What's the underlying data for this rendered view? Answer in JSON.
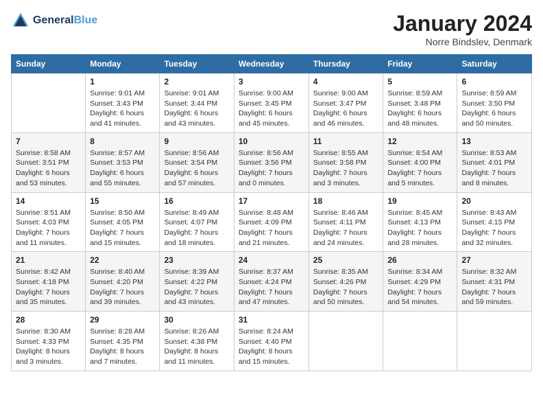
{
  "header": {
    "logo_line1": "General",
    "logo_line2": "Blue",
    "month_title": "January 2024",
    "subtitle": "Norre Bindslev, Denmark"
  },
  "columns": [
    "Sunday",
    "Monday",
    "Tuesday",
    "Wednesday",
    "Thursday",
    "Friday",
    "Saturday"
  ],
  "weeks": [
    [
      {
        "day": "",
        "sunrise": "",
        "sunset": "",
        "daylight": ""
      },
      {
        "day": "1",
        "sunrise": "9:01 AM",
        "sunset": "3:43 PM",
        "daylight": "6 hours and 41 minutes."
      },
      {
        "day": "2",
        "sunrise": "9:01 AM",
        "sunset": "3:44 PM",
        "daylight": "6 hours and 43 minutes."
      },
      {
        "day": "3",
        "sunrise": "9:00 AM",
        "sunset": "3:45 PM",
        "daylight": "6 hours and 45 minutes."
      },
      {
        "day": "4",
        "sunrise": "9:00 AM",
        "sunset": "3:47 PM",
        "daylight": "6 hours and 46 minutes."
      },
      {
        "day": "5",
        "sunrise": "8:59 AM",
        "sunset": "3:48 PM",
        "daylight": "6 hours and 48 minutes."
      },
      {
        "day": "6",
        "sunrise": "8:59 AM",
        "sunset": "3:50 PM",
        "daylight": "6 hours and 50 minutes."
      }
    ],
    [
      {
        "day": "7",
        "sunrise": "8:58 AM",
        "sunset": "3:51 PM",
        "daylight": "6 hours and 53 minutes."
      },
      {
        "day": "8",
        "sunrise": "8:57 AM",
        "sunset": "3:53 PM",
        "daylight": "6 hours and 55 minutes."
      },
      {
        "day": "9",
        "sunrise": "8:56 AM",
        "sunset": "3:54 PM",
        "daylight": "6 hours and 57 minutes."
      },
      {
        "day": "10",
        "sunrise": "8:56 AM",
        "sunset": "3:56 PM",
        "daylight": "7 hours and 0 minutes."
      },
      {
        "day": "11",
        "sunrise": "8:55 AM",
        "sunset": "3:58 PM",
        "daylight": "7 hours and 3 minutes."
      },
      {
        "day": "12",
        "sunrise": "8:54 AM",
        "sunset": "4:00 PM",
        "daylight": "7 hours and 5 minutes."
      },
      {
        "day": "13",
        "sunrise": "8:53 AM",
        "sunset": "4:01 PM",
        "daylight": "7 hours and 8 minutes."
      }
    ],
    [
      {
        "day": "14",
        "sunrise": "8:51 AM",
        "sunset": "4:03 PM",
        "daylight": "7 hours and 11 minutes."
      },
      {
        "day": "15",
        "sunrise": "8:50 AM",
        "sunset": "4:05 PM",
        "daylight": "7 hours and 15 minutes."
      },
      {
        "day": "16",
        "sunrise": "8:49 AM",
        "sunset": "4:07 PM",
        "daylight": "7 hours and 18 minutes."
      },
      {
        "day": "17",
        "sunrise": "8:48 AM",
        "sunset": "4:09 PM",
        "daylight": "7 hours and 21 minutes."
      },
      {
        "day": "18",
        "sunrise": "8:46 AM",
        "sunset": "4:11 PM",
        "daylight": "7 hours and 24 minutes."
      },
      {
        "day": "19",
        "sunrise": "8:45 AM",
        "sunset": "4:13 PM",
        "daylight": "7 hours and 28 minutes."
      },
      {
        "day": "20",
        "sunrise": "8:43 AM",
        "sunset": "4:15 PM",
        "daylight": "7 hours and 32 minutes."
      }
    ],
    [
      {
        "day": "21",
        "sunrise": "8:42 AM",
        "sunset": "4:18 PM",
        "daylight": "7 hours and 35 minutes."
      },
      {
        "day": "22",
        "sunrise": "8:40 AM",
        "sunset": "4:20 PM",
        "daylight": "7 hours and 39 minutes."
      },
      {
        "day": "23",
        "sunrise": "8:39 AM",
        "sunset": "4:22 PM",
        "daylight": "7 hours and 43 minutes."
      },
      {
        "day": "24",
        "sunrise": "8:37 AM",
        "sunset": "4:24 PM",
        "daylight": "7 hours and 47 minutes."
      },
      {
        "day": "25",
        "sunrise": "8:35 AM",
        "sunset": "4:26 PM",
        "daylight": "7 hours and 50 minutes."
      },
      {
        "day": "26",
        "sunrise": "8:34 AM",
        "sunset": "4:29 PM",
        "daylight": "7 hours and 54 minutes."
      },
      {
        "day": "27",
        "sunrise": "8:32 AM",
        "sunset": "4:31 PM",
        "daylight": "7 hours and 59 minutes."
      }
    ],
    [
      {
        "day": "28",
        "sunrise": "8:30 AM",
        "sunset": "4:33 PM",
        "daylight": "8 hours and 3 minutes."
      },
      {
        "day": "29",
        "sunrise": "8:28 AM",
        "sunset": "4:35 PM",
        "daylight": "8 hours and 7 minutes."
      },
      {
        "day": "30",
        "sunrise": "8:26 AM",
        "sunset": "4:38 PM",
        "daylight": "8 hours and 11 minutes."
      },
      {
        "day": "31",
        "sunrise": "8:24 AM",
        "sunset": "4:40 PM",
        "daylight": "8 hours and 15 minutes."
      },
      {
        "day": "",
        "sunrise": "",
        "sunset": "",
        "daylight": ""
      },
      {
        "day": "",
        "sunrise": "",
        "sunset": "",
        "daylight": ""
      },
      {
        "day": "",
        "sunrise": "",
        "sunset": "",
        "daylight": ""
      }
    ]
  ]
}
